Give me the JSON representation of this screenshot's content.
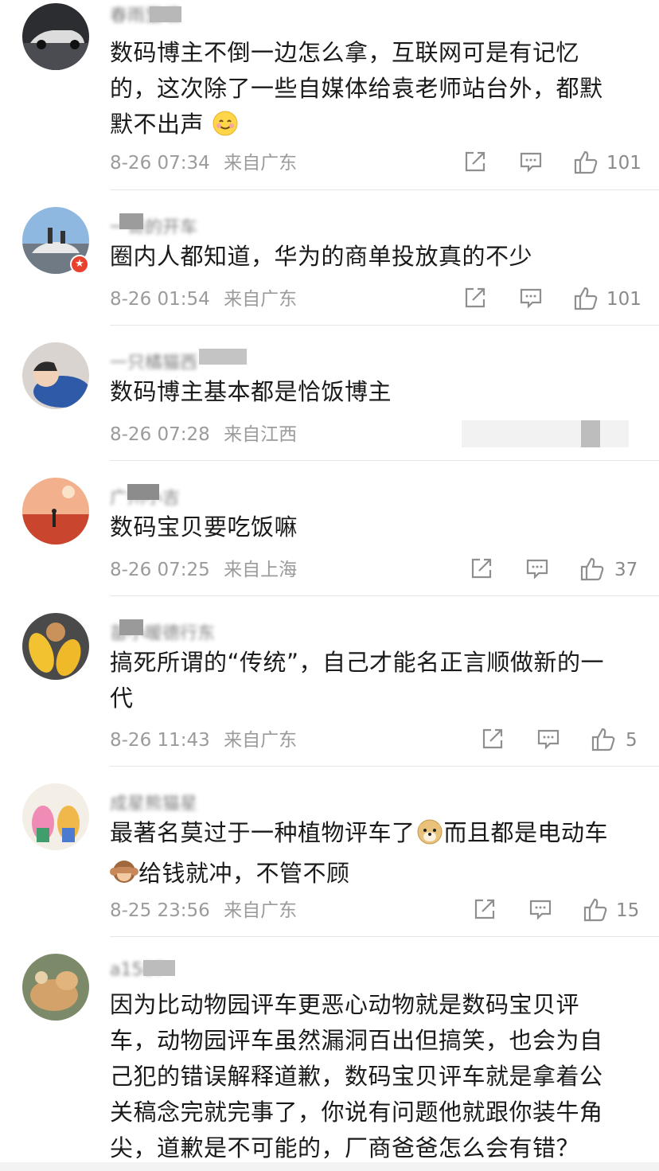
{
  "comments": [
    {
      "username": "春雨里晒",
      "text_lines": [
        "数码博主不倒一边怎么拿，互联网可是有记忆",
        "的，这次除了一些自媒体给袁老师站台外，都默",
        "默不出声"
      ],
      "emoji": "smile-emoji",
      "date": "8-26 07:34",
      "location": "来自广东",
      "likes": "101"
    },
    {
      "username": "一哥的开车",
      "text_lines": [
        "圈内人都知道，华为的商单投放真的不少"
      ],
      "date": "8-26 01:54",
      "location": "来自广东",
      "likes": "101"
    },
    {
      "username": "一只橘猫西",
      "text_lines": [
        "数码博主基本都是恰饭博主"
      ],
      "date": "8-26 07:28",
      "location": "来自江西",
      "likes": ""
    },
    {
      "username": "广州小吉",
      "text_lines": [
        "数码宝贝要吃饭嘛"
      ],
      "date": "8-26 07:25",
      "location": "来自上海",
      "likes": "37"
    },
    {
      "username": "苗小暖德行东",
      "text_lines": [
        "搞死所谓的“传统”，自己才能名正言顺做新的一",
        "代"
      ],
      "date": "8-26 11:43",
      "location": "来自广东",
      "likes": "5"
    },
    {
      "username": "成星熊猫星",
      "text_lines": [
        "最著名莫过于一种植物评车了",
        "给钱就冲，不管不顾"
      ],
      "inline_emoji_1": "doge-emoji",
      "inline_emoji_2": "see-no-evil-monkey-emoji",
      "inline_tail": "而且都是电动车",
      "date": "8-25 23:56",
      "location": "来自广东",
      "likes": "15"
    },
    {
      "username": "a1587",
      "text_lines": [
        "因为比动物园评车更恶心动物就是数码宝贝评",
        "车，动物园评车虽然漏洞百出但搞笑，也会为自",
        "己犯的错误解释道歉，数码宝贝评车就是拿着公",
        "关稿念完就完事了，你说有问题他就跟你装牛角",
        "尖，道歉是不可能的，厂商爸爸怎么会有错？"
      ]
    }
  ],
  "colors": {
    "text": "#1a1a1a",
    "meta": "#9b9b9b",
    "icon": "#8f8f8f",
    "badge": "#e8412d"
  },
  "icons": [
    "share-icon",
    "comment-icon",
    "like-icon"
  ]
}
